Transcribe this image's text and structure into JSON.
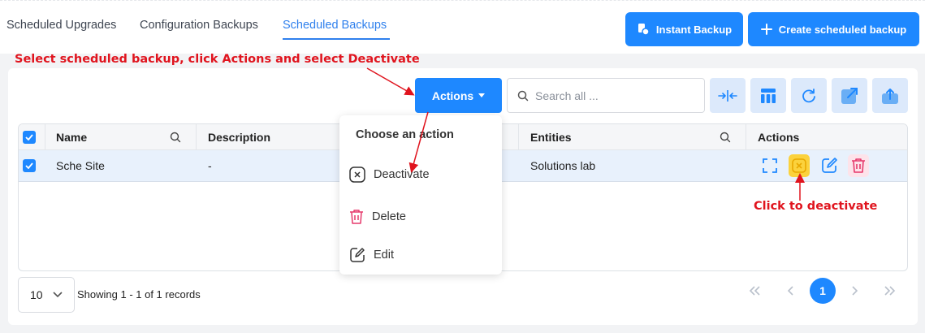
{
  "tabs": [
    {
      "label": "Scheduled Upgrades",
      "active": false
    },
    {
      "label": "Configuration Backups",
      "active": false
    },
    {
      "label": "Scheduled Backups",
      "active": true
    }
  ],
  "buttons": {
    "instant_backup": "Instant Backup",
    "create_scheduled_backup": "Create scheduled backup",
    "actions": "Actions"
  },
  "search": {
    "placeholder": "Search all ..."
  },
  "annotations": {
    "top": "Select scheduled backup, click Actions and select Deactivate",
    "right": "Click to deactivate"
  },
  "table": {
    "columns": {
      "name": "Name",
      "description": "Description",
      "entities": "Entities",
      "actions": "Actions"
    },
    "rows": [
      {
        "name": "Sche Site",
        "description": "-",
        "entities": "Solutions lab",
        "checked": true
      }
    ]
  },
  "dropdown": {
    "header": "Choose an action",
    "items": [
      {
        "label": "Deactivate",
        "icon": "x-circle-icon"
      },
      {
        "label": "Delete",
        "icon": "trash-icon"
      },
      {
        "label": "Edit",
        "icon": "edit-icon"
      }
    ]
  },
  "pagination": {
    "page_size": "10",
    "records_text": "Showing 1 - 1 of 1 records",
    "current_page": "1"
  },
  "colors": {
    "primary": "#1e88ff",
    "annotation": "#e0141e",
    "deactivate_highlight": "#fbd23d",
    "delete": "#e6386b"
  }
}
